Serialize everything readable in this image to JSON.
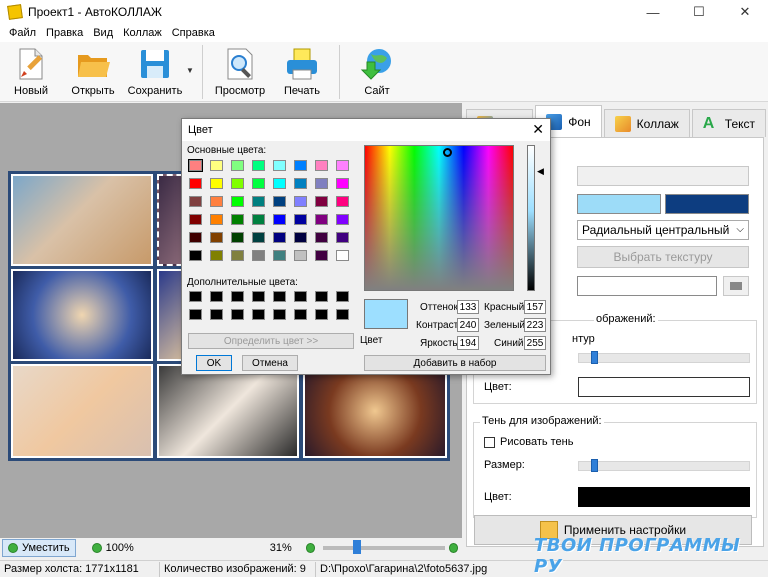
{
  "window": {
    "title": "Проект1 - АвтоКОЛЛАЖ",
    "minimize": "—",
    "maximize": "☐",
    "close": "✕"
  },
  "menu": [
    "Файл",
    "Правка",
    "Вид",
    "Коллаж",
    "Справка"
  ],
  "toolbar": {
    "new": "Новый",
    "open": "Открыть",
    "save": "Сохранить",
    "preview": "Просмотр",
    "print": "Печать",
    "site": "Сайт"
  },
  "tabs": {
    "bg": "Фон",
    "collage": "Коллаж",
    "text": "Текст"
  },
  "background": {
    "color1": "#9ddcf8",
    "color2": "#0d3d80",
    "gradient": "Радиальный центральный",
    "texture_button": "Выбрать текстуру"
  },
  "border_group": {
    "title_tail": "ображений:",
    "outline_tail": "нтур",
    "color_label": "Цвет:",
    "color": "#ffffff"
  },
  "shadow_group": {
    "title": "Тень для изображений:",
    "draw_label": "Рисовать тень",
    "size_label": "Размер:",
    "color_label": "Цвет:",
    "color": "#000000"
  },
  "apply_button": "Применить настройки",
  "zoom": {
    "fit": "Уместить",
    "hundred": "100%",
    "percent": "31%"
  },
  "status": {
    "canvas_size": "Размер холста: 1771x1181",
    "image_count": "Количество изображений: 9",
    "path": "D:\\Прохо\\Гагарина\\2\\foto5637.jpg"
  },
  "dialog": {
    "title": "Цвет",
    "basic_colors": "Основные цвета:",
    "custom_colors": "Дополнительные цвета:",
    "define": "Определить цвет >>",
    "ok": "OK",
    "cancel": "Отмена",
    "color_solid": "Цвет",
    "add": "Добавить в набор",
    "hue_label": "Оттенок:",
    "hue": "133",
    "sat_label": "Контраст:",
    "sat": "240",
    "lum_label": "Яркость:",
    "lum": "194",
    "red_label": "Красный:",
    "red": "157",
    "green_label": "Зеленый:",
    "green": "223",
    "blue_label": "Синий:",
    "blue": "255",
    "preview_color": "#9ddfff",
    "swatches": [
      "#ff8080",
      "#ffff80",
      "#80ff80",
      "#00ff80",
      "#80ffff",
      "#0080ff",
      "#ff80c0",
      "#ff80ff",
      "#ff0000",
      "#ffff00",
      "#80ff00",
      "#00ff40",
      "#00ffff",
      "#0080c0",
      "#8080c0",
      "#ff00ff",
      "#804040",
      "#ff8040",
      "#00ff00",
      "#008080",
      "#004080",
      "#8080ff",
      "#800040",
      "#ff0080",
      "#800000",
      "#ff8000",
      "#008000",
      "#008040",
      "#0000ff",
      "#0000a0",
      "#800080",
      "#8000ff",
      "#400000",
      "#804000",
      "#004000",
      "#004040",
      "#000080",
      "#000040",
      "#400040",
      "#400080",
      "#000000",
      "#808000",
      "#808040",
      "#808080",
      "#408080",
      "#c0c0c0",
      "#400040",
      "#ffffff"
    ]
  },
  "watermark": "ТВОИ ПРОГРАММЫ РУ"
}
